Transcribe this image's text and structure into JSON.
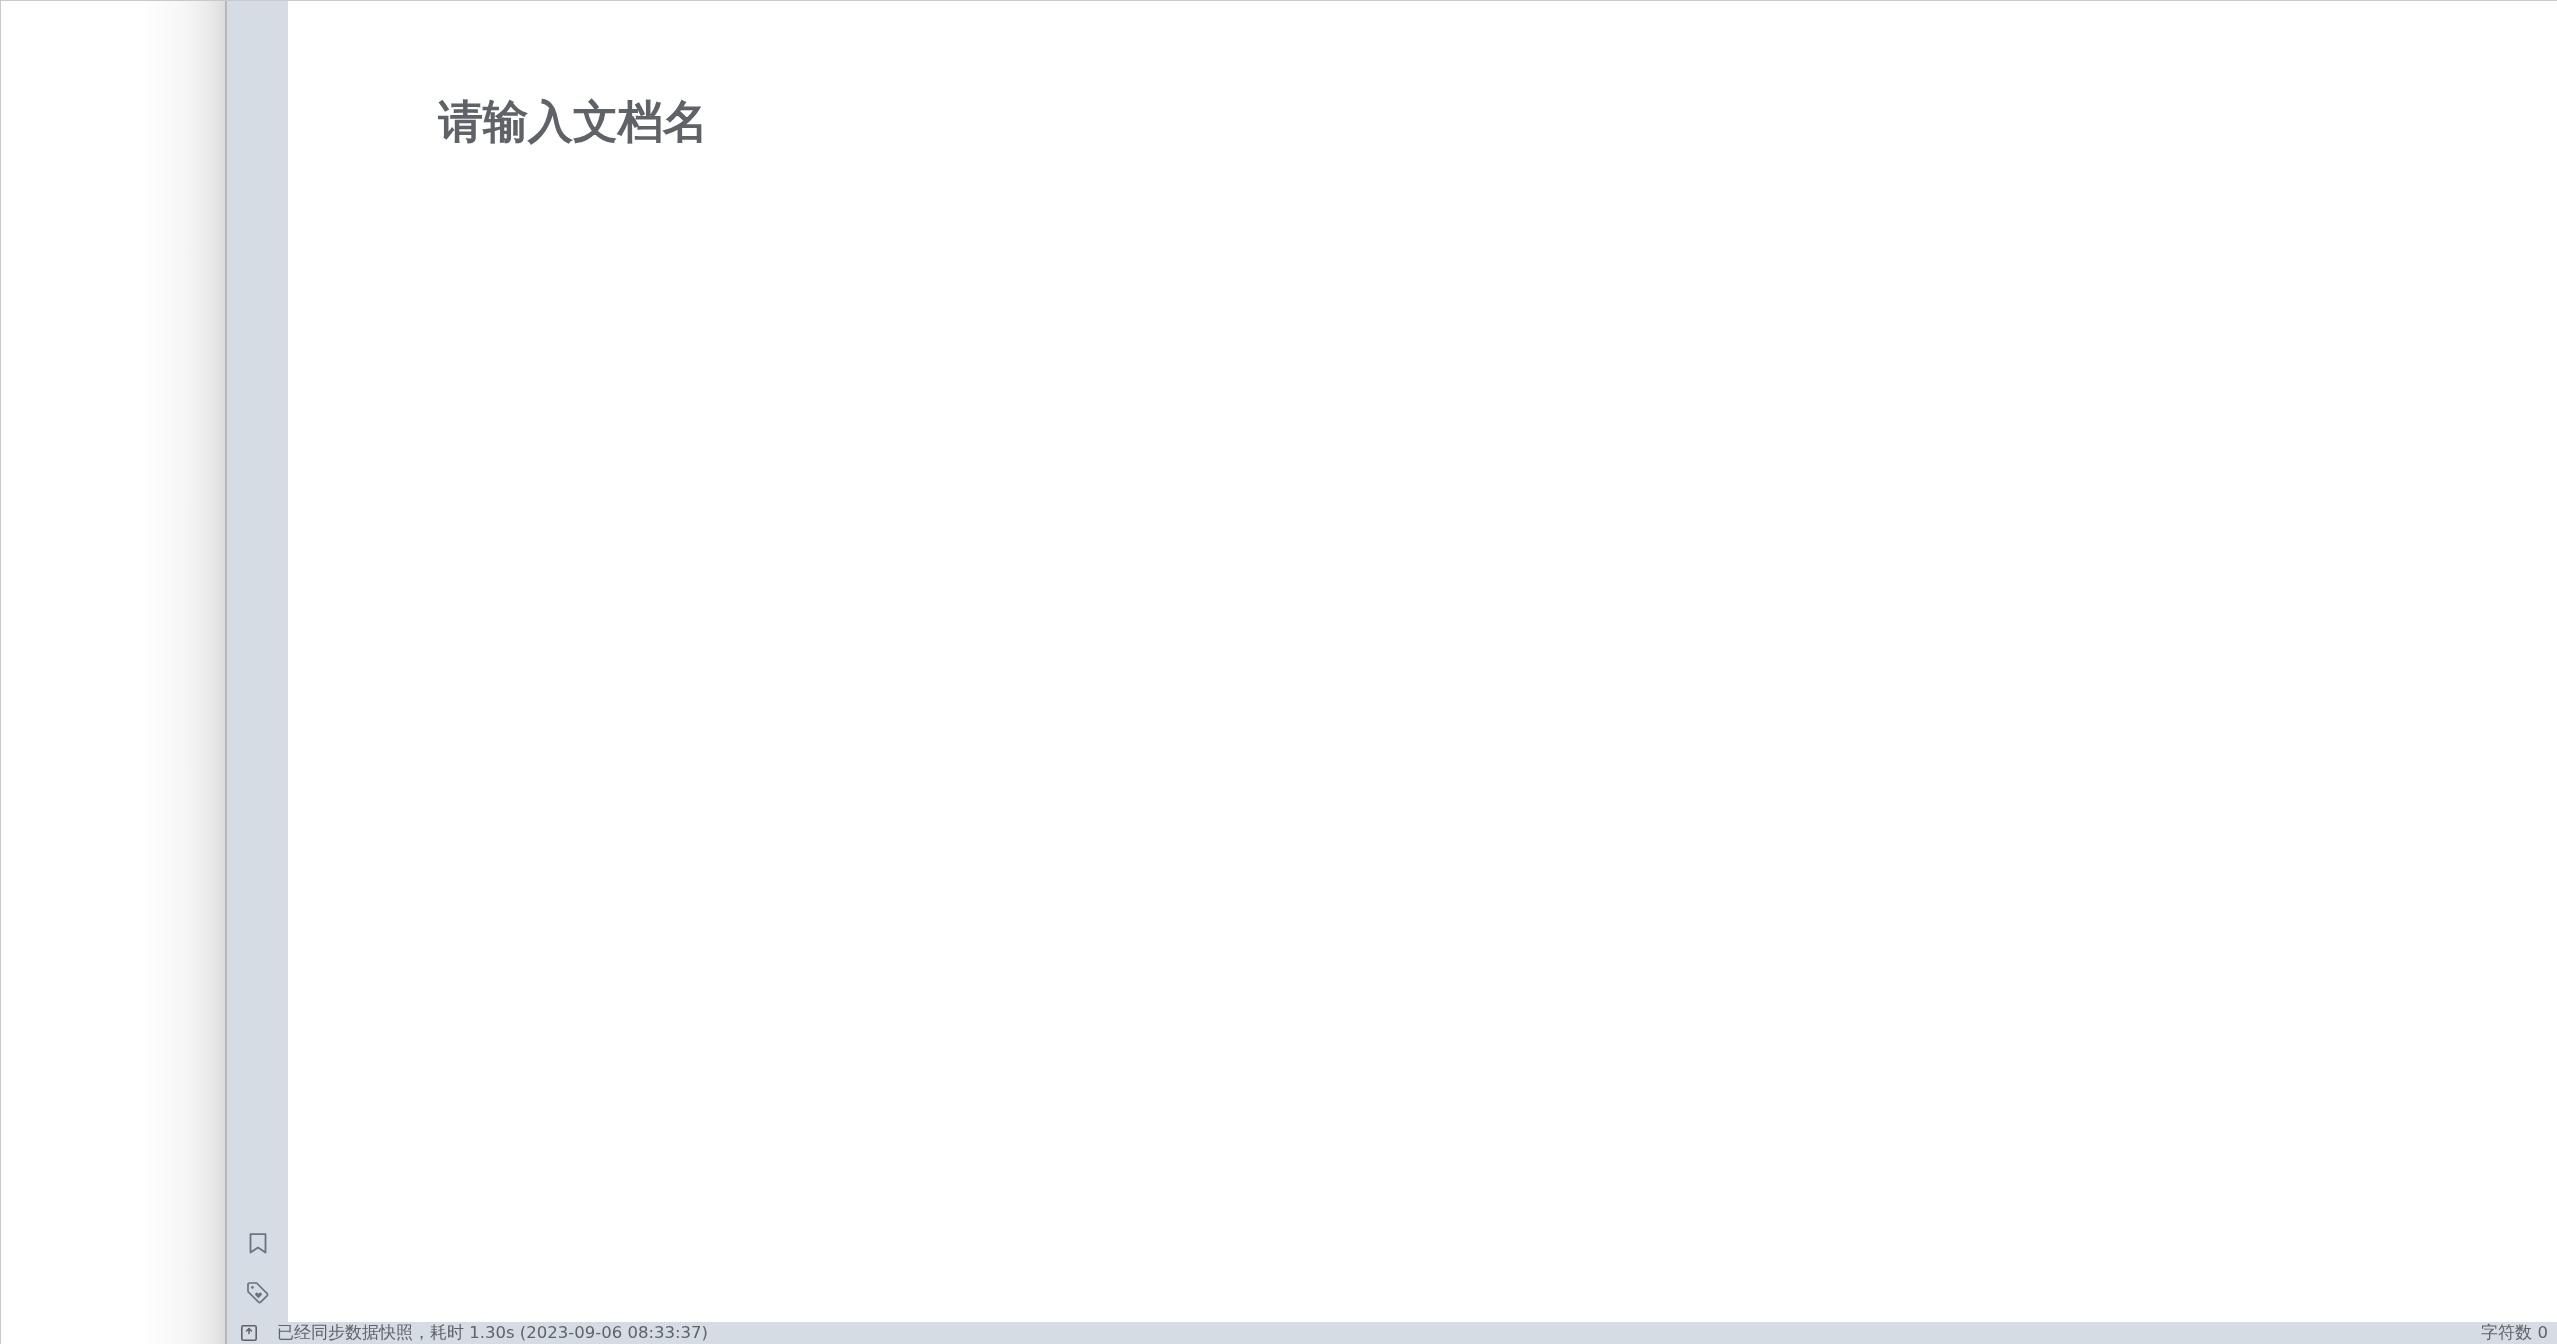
{
  "editor": {
    "title": {
      "placeholder": "请输入文档名"
    }
  },
  "status_bar": {
    "message": "已经同步数据快照，耗时 1.30s (2023-09-06 08:33:37)",
    "character_count": "字符数 0"
  }
}
